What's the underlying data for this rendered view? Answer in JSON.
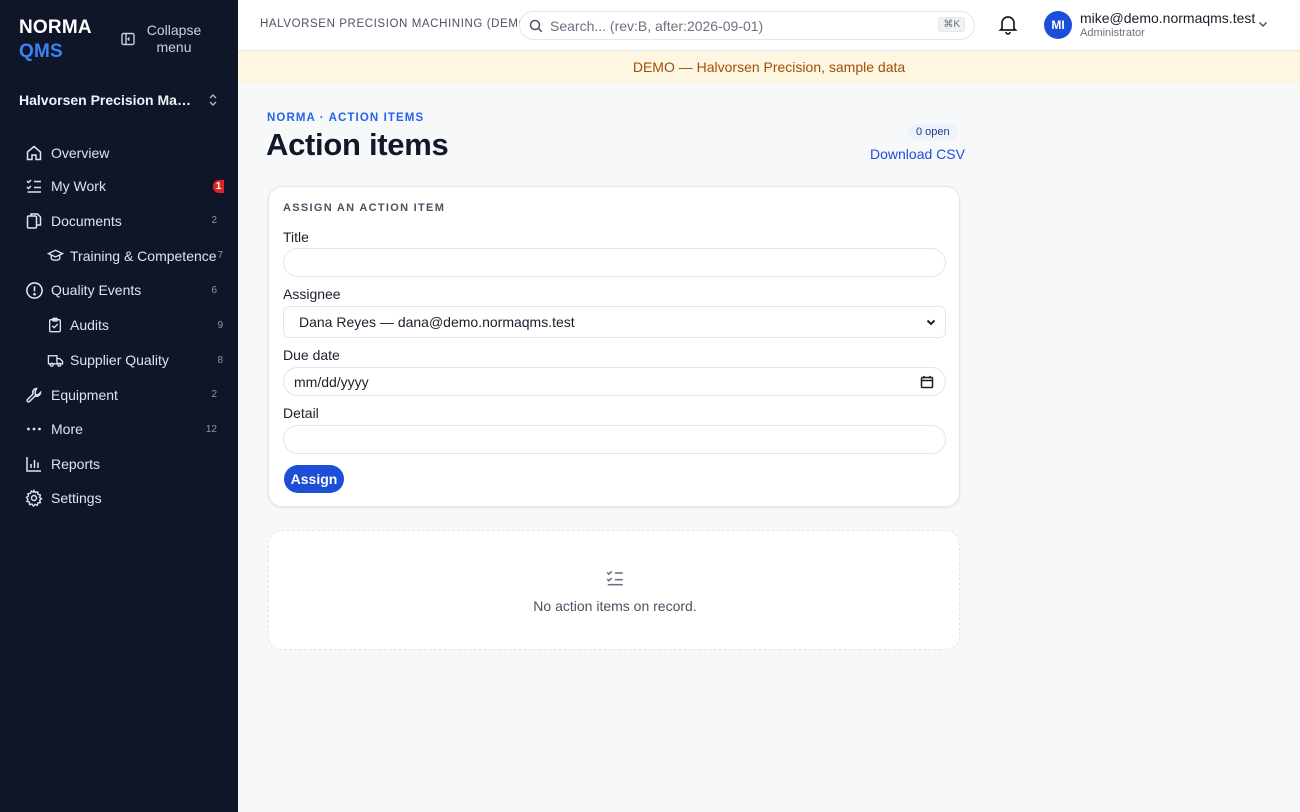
{
  "sidebar": {
    "brand": {
      "line1": "NORMA",
      "line2": "QMS"
    },
    "collapse_label": "Collapse menu",
    "org_name": "Halvorsen Precision Machi...",
    "items": [
      {
        "label": "Overview",
        "icon": "home-icon"
      },
      {
        "label": "My Work",
        "icon": "checklist-icon",
        "badge": "1"
      },
      {
        "label": "Documents",
        "icon": "documents-icon",
        "count": "2"
      },
      {
        "label": "Training & Competence",
        "icon": "graduation-cap-icon",
        "count": "7",
        "sub": true
      },
      {
        "label": "Quality Events",
        "icon": "alert-circle-icon",
        "count": "6"
      },
      {
        "label": "Audits",
        "icon": "clipboard-check-icon",
        "count": "9",
        "sub": true
      },
      {
        "label": "Supplier Quality",
        "icon": "truck-icon",
        "count": "8",
        "sub": true
      },
      {
        "label": "Equipment",
        "icon": "wrench-icon",
        "count": "2"
      },
      {
        "label": "More",
        "icon": "more-dots-icon",
        "count": "12"
      },
      {
        "label": "Reports",
        "icon": "bar-chart-icon"
      },
      {
        "label": "Settings",
        "icon": "gear-icon"
      }
    ]
  },
  "topbar": {
    "org_label": "HALVORSEN PRECISION MACHINING (DEMO)",
    "search_placeholder": "Search... (rev:B, after:2026-09-01)",
    "search_shortcut": "⌘K",
    "avatar_initials": "MI",
    "user_email": "mike@demo.normaqms.test",
    "user_role": "Administrator"
  },
  "banner": "DEMO — Halvorsen Precision, sample data",
  "page": {
    "breadcrumb": "NORMA · ACTION ITEMS",
    "title": "Action items",
    "open_count": "0 open",
    "download_label": "Download CSV"
  },
  "form": {
    "heading": "ASSIGN AN ACTION ITEM",
    "title_label": "Title",
    "title_value": "",
    "assignee_label": "Assignee",
    "assignee_value": "Dana Reyes — dana@demo.normaqms.test",
    "due_label": "Due date",
    "due_placeholder": "mm/dd/yyyy",
    "detail_label": "Detail",
    "detail_value": "",
    "submit_label": "Assign"
  },
  "empty_state": {
    "message": "No action items on record."
  },
  "colors": {
    "sidebar_bg": "#0e1628",
    "accent": "#1d4ed8",
    "badge": "#dc2626",
    "banner_bg": "#fdf7e2",
    "banner_text": "#a14e07"
  }
}
